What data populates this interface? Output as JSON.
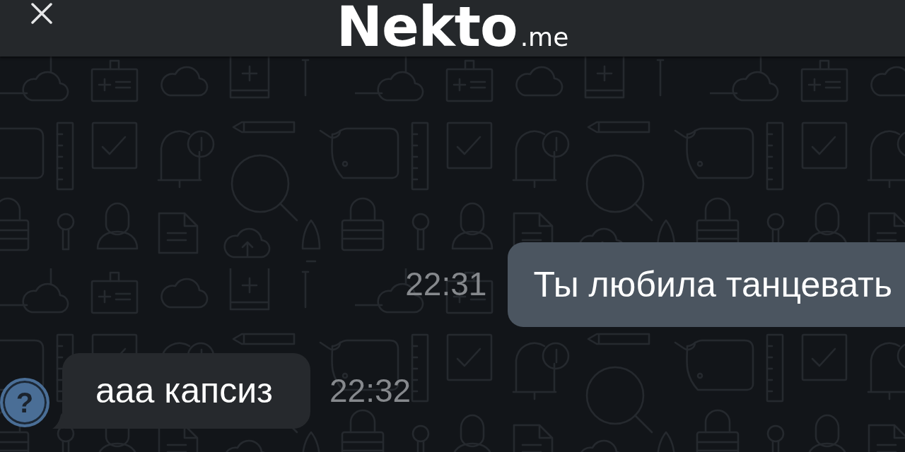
{
  "header": {
    "logo": {
      "name": "Nekto",
      "domain": ".me"
    }
  },
  "messages": [
    {
      "kind": "outgoing",
      "text": "Ты любила танцевать",
      "time": "22:31"
    },
    {
      "kind": "incoming",
      "avatar": "?",
      "text": "ааа капсиз",
      "time": "22:32"
    }
  ]
}
